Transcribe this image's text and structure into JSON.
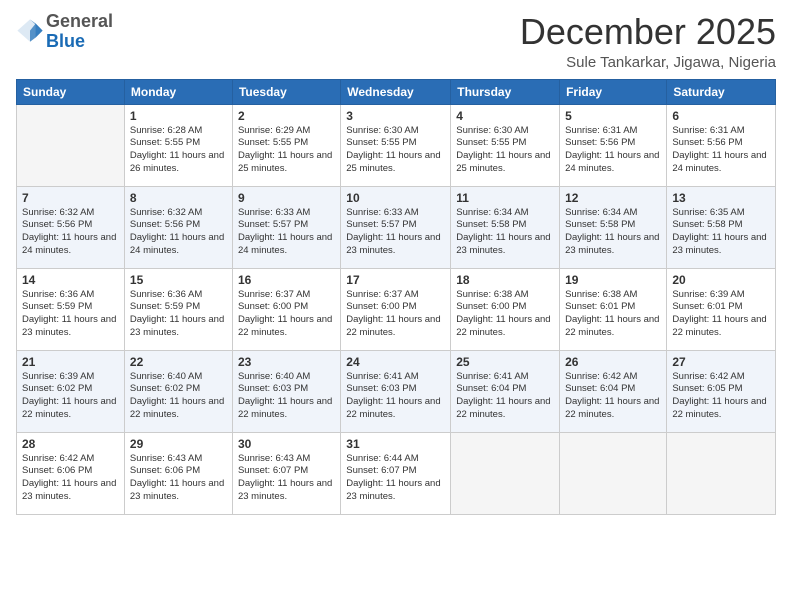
{
  "header": {
    "logo": {
      "general": "General",
      "blue": "Blue"
    },
    "month": "December 2025",
    "location": "Sule Tankarkar, Jigawa, Nigeria"
  },
  "days_of_week": [
    "Sunday",
    "Monday",
    "Tuesday",
    "Wednesday",
    "Thursday",
    "Friday",
    "Saturday"
  ],
  "weeks": [
    [
      {
        "day": "",
        "sunrise": "",
        "sunset": "",
        "daylight": "",
        "empty": true
      },
      {
        "day": "1",
        "sunrise": "Sunrise: 6:28 AM",
        "sunset": "Sunset: 5:55 PM",
        "daylight": "Daylight: 11 hours and 26 minutes."
      },
      {
        "day": "2",
        "sunrise": "Sunrise: 6:29 AM",
        "sunset": "Sunset: 5:55 PM",
        "daylight": "Daylight: 11 hours and 25 minutes."
      },
      {
        "day": "3",
        "sunrise": "Sunrise: 6:30 AM",
        "sunset": "Sunset: 5:55 PM",
        "daylight": "Daylight: 11 hours and 25 minutes."
      },
      {
        "day": "4",
        "sunrise": "Sunrise: 6:30 AM",
        "sunset": "Sunset: 5:55 PM",
        "daylight": "Daylight: 11 hours and 25 minutes."
      },
      {
        "day": "5",
        "sunrise": "Sunrise: 6:31 AM",
        "sunset": "Sunset: 5:56 PM",
        "daylight": "Daylight: 11 hours and 24 minutes."
      },
      {
        "day": "6",
        "sunrise": "Sunrise: 6:31 AM",
        "sunset": "Sunset: 5:56 PM",
        "daylight": "Daylight: 11 hours and 24 minutes."
      }
    ],
    [
      {
        "day": "7",
        "sunrise": "Sunrise: 6:32 AM",
        "sunset": "Sunset: 5:56 PM",
        "daylight": "Daylight: 11 hours and 24 minutes."
      },
      {
        "day": "8",
        "sunrise": "Sunrise: 6:32 AM",
        "sunset": "Sunset: 5:56 PM",
        "daylight": "Daylight: 11 hours and 24 minutes."
      },
      {
        "day": "9",
        "sunrise": "Sunrise: 6:33 AM",
        "sunset": "Sunset: 5:57 PM",
        "daylight": "Daylight: 11 hours and 24 minutes."
      },
      {
        "day": "10",
        "sunrise": "Sunrise: 6:33 AM",
        "sunset": "Sunset: 5:57 PM",
        "daylight": "Daylight: 11 hours and 23 minutes."
      },
      {
        "day": "11",
        "sunrise": "Sunrise: 6:34 AM",
        "sunset": "Sunset: 5:58 PM",
        "daylight": "Daylight: 11 hours and 23 minutes."
      },
      {
        "day": "12",
        "sunrise": "Sunrise: 6:34 AM",
        "sunset": "Sunset: 5:58 PM",
        "daylight": "Daylight: 11 hours and 23 minutes."
      },
      {
        "day": "13",
        "sunrise": "Sunrise: 6:35 AM",
        "sunset": "Sunset: 5:58 PM",
        "daylight": "Daylight: 11 hours and 23 minutes."
      }
    ],
    [
      {
        "day": "14",
        "sunrise": "Sunrise: 6:36 AM",
        "sunset": "Sunset: 5:59 PM",
        "daylight": "Daylight: 11 hours and 23 minutes."
      },
      {
        "day": "15",
        "sunrise": "Sunrise: 6:36 AM",
        "sunset": "Sunset: 5:59 PM",
        "daylight": "Daylight: 11 hours and 23 minutes."
      },
      {
        "day": "16",
        "sunrise": "Sunrise: 6:37 AM",
        "sunset": "Sunset: 6:00 PM",
        "daylight": "Daylight: 11 hours and 22 minutes."
      },
      {
        "day": "17",
        "sunrise": "Sunrise: 6:37 AM",
        "sunset": "Sunset: 6:00 PM",
        "daylight": "Daylight: 11 hours and 22 minutes."
      },
      {
        "day": "18",
        "sunrise": "Sunrise: 6:38 AM",
        "sunset": "Sunset: 6:00 PM",
        "daylight": "Daylight: 11 hours and 22 minutes."
      },
      {
        "day": "19",
        "sunrise": "Sunrise: 6:38 AM",
        "sunset": "Sunset: 6:01 PM",
        "daylight": "Daylight: 11 hours and 22 minutes."
      },
      {
        "day": "20",
        "sunrise": "Sunrise: 6:39 AM",
        "sunset": "Sunset: 6:01 PM",
        "daylight": "Daylight: 11 hours and 22 minutes."
      }
    ],
    [
      {
        "day": "21",
        "sunrise": "Sunrise: 6:39 AM",
        "sunset": "Sunset: 6:02 PM",
        "daylight": "Daylight: 11 hours and 22 minutes."
      },
      {
        "day": "22",
        "sunrise": "Sunrise: 6:40 AM",
        "sunset": "Sunset: 6:02 PM",
        "daylight": "Daylight: 11 hours and 22 minutes."
      },
      {
        "day": "23",
        "sunrise": "Sunrise: 6:40 AM",
        "sunset": "Sunset: 6:03 PM",
        "daylight": "Daylight: 11 hours and 22 minutes."
      },
      {
        "day": "24",
        "sunrise": "Sunrise: 6:41 AM",
        "sunset": "Sunset: 6:03 PM",
        "daylight": "Daylight: 11 hours and 22 minutes."
      },
      {
        "day": "25",
        "sunrise": "Sunrise: 6:41 AM",
        "sunset": "Sunset: 6:04 PM",
        "daylight": "Daylight: 11 hours and 22 minutes."
      },
      {
        "day": "26",
        "sunrise": "Sunrise: 6:42 AM",
        "sunset": "Sunset: 6:04 PM",
        "daylight": "Daylight: 11 hours and 22 minutes."
      },
      {
        "day": "27",
        "sunrise": "Sunrise: 6:42 AM",
        "sunset": "Sunset: 6:05 PM",
        "daylight": "Daylight: 11 hours and 22 minutes."
      }
    ],
    [
      {
        "day": "28",
        "sunrise": "Sunrise: 6:42 AM",
        "sunset": "Sunset: 6:06 PM",
        "daylight": "Daylight: 11 hours and 23 minutes."
      },
      {
        "day": "29",
        "sunrise": "Sunrise: 6:43 AM",
        "sunset": "Sunset: 6:06 PM",
        "daylight": "Daylight: 11 hours and 23 minutes."
      },
      {
        "day": "30",
        "sunrise": "Sunrise: 6:43 AM",
        "sunset": "Sunset: 6:07 PM",
        "daylight": "Daylight: 11 hours and 23 minutes."
      },
      {
        "day": "31",
        "sunrise": "Sunrise: 6:44 AM",
        "sunset": "Sunset: 6:07 PM",
        "daylight": "Daylight: 11 hours and 23 minutes."
      },
      {
        "day": "",
        "sunrise": "",
        "sunset": "",
        "daylight": "",
        "empty": true
      },
      {
        "day": "",
        "sunrise": "",
        "sunset": "",
        "daylight": "",
        "empty": true
      },
      {
        "day": "",
        "sunrise": "",
        "sunset": "",
        "daylight": "",
        "empty": true
      }
    ]
  ]
}
